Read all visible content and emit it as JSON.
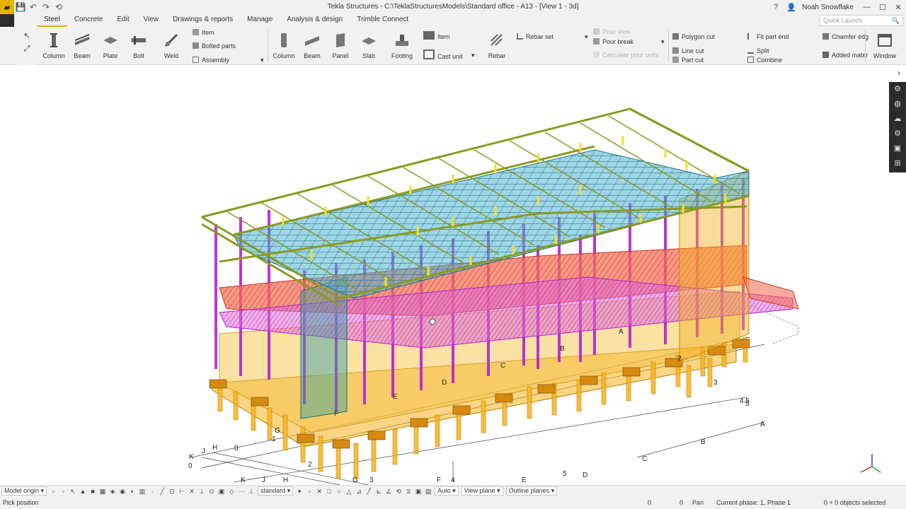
{
  "titlebar": {
    "title": "Tekla Structures - C:\\TeklaStructuresModels\\Standard office - A13 - [View 1 - 3d]",
    "user": "Noah Snowflake",
    "help": "?",
    "minimize": "—",
    "maximize": "☐",
    "close": "✕"
  },
  "tabs": [
    "Steel",
    "Concrete",
    "Edit",
    "View",
    "Drawings & reports",
    "Manage",
    "Analysis & design",
    "Trimble Connect"
  ],
  "quick_launch": {
    "placeholder": "Quick Launch"
  },
  "ribbon": {
    "steel": {
      "column": "Column",
      "beam": "Beam",
      "plate": "Plate",
      "bolt": "Bolt",
      "weld": "Weld",
      "item": "Item",
      "bolted_parts": "Bolted parts",
      "assembly": "Assembly"
    },
    "concrete": {
      "column": "Column",
      "beam": "Beam",
      "panel": "Panel",
      "slab": "Slab",
      "footing": "Footing",
      "item": "Item",
      "cast_unit": "Cast unit",
      "rebar": "Rebar",
      "rebar_set": "Rebar set",
      "pour_view": "Pour view",
      "pour_break": "Pour break",
      "calculate_pour_units": "Calculate pour units"
    },
    "edit": {
      "polygon_cut": "Polygon cut",
      "line_cut": "Line cut",
      "part_cut": "Part cut",
      "fit_part_end": "Fit part end",
      "split": "Split",
      "combine": "Combine",
      "chamfer_edge": "Chamfer edg",
      "added_material": "Added mater"
    },
    "window": "Window"
  },
  "grid_labels": {
    "front": [
      "K",
      "J",
      "H",
      "0",
      "K",
      "0",
      "J",
      "H",
      "G",
      "1",
      "2",
      "G",
      "3",
      "F",
      "4",
      "E"
    ],
    "right": [
      "A",
      "B",
      "C",
      "D",
      "5",
      "4.5",
      "3",
      "2",
      "A",
      "B",
      "C",
      "D",
      "E",
      "F"
    ],
    "misc": [
      "0",
      "5",
      "D"
    ]
  },
  "bottombar": {
    "model_origin": "Model origin",
    "standard": "standard",
    "auto": "Auto",
    "view_plane": "View plane",
    "outline_planes": "Outline planes"
  },
  "statusbar": {
    "prompt": "Pick position",
    "coord_x": "0",
    "coord_y": "0",
    "mode": "Pan",
    "phase": "Current phase: 1, Phase 1",
    "selection": "0 + 0 objects selected"
  },
  "colors": {
    "steel_frame": "#b51fd0",
    "roof_beams": "#8a9a20",
    "roof_deck": "#3f9fc0",
    "concrete": "#f4b21f",
    "slab_red": "#f0604a",
    "glass": "#30a0a0",
    "accent": "#e8b100"
  }
}
